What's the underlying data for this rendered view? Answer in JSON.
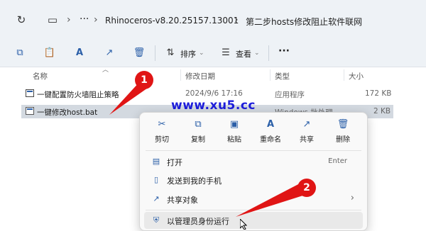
{
  "breadcrumb": {
    "items": [
      "Rhinoceros-v8.20.25157.13001",
      "第二步hosts修改阻止软件联网"
    ],
    "more": "···"
  },
  "toolbar": {
    "sort_label": "排序",
    "view_label": "查看",
    "more_label": "···"
  },
  "columns": {
    "name": "名称",
    "modified": "修改日期",
    "type": "类型",
    "size": "大小"
  },
  "files": [
    {
      "name": "一键配置防火墙阻止策略",
      "modified": "2024/9/6 17:16",
      "type": "应用程序",
      "size": "172 KB"
    },
    {
      "name": "一键修改host.bat",
      "modified": "",
      "type": "Windows 批处理",
      "size": "2 KB"
    }
  ],
  "watermark": "www.xu5.cc",
  "context_menu": {
    "quick_actions": [
      {
        "label": "剪切",
        "icon": "scissors-icon"
      },
      {
        "label": "复制",
        "icon": "copy-icon"
      },
      {
        "label": "粘贴",
        "icon": "paste-icon"
      },
      {
        "label": "重命名",
        "icon": "rename-icon"
      },
      {
        "label": "共享",
        "icon": "share-icon"
      },
      {
        "label": "删除",
        "icon": "trash-icon"
      }
    ],
    "items": [
      {
        "label": "打开",
        "shortcut": "Enter",
        "icon": "open-icon"
      },
      {
        "label": "发送到我的手机",
        "icon": "phone-icon"
      },
      {
        "label": "共享对象",
        "icon": "share-icon",
        "submenu_arrow": "›"
      },
      {
        "label": "以管理员身份运行",
        "icon": "shield-icon"
      }
    ]
  },
  "annotations": {
    "badge1": "1",
    "badge2": "2"
  },
  "colors": {
    "accent": "#2b5fa8",
    "annotation_red": "#e01515",
    "watermark": "#1d1ddb"
  }
}
